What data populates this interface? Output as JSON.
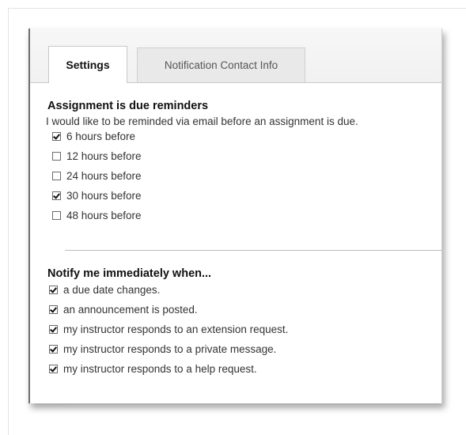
{
  "tabs": {
    "settings_label": "Settings",
    "contact_label": "Notification Contact Info"
  },
  "reminders": {
    "title": "Assignment is due reminders",
    "description": "I would like to be reminded via email before an assignment is due.",
    "options": [
      {
        "label": "6 hours before",
        "checked": true
      },
      {
        "label": "12 hours before",
        "checked": false
      },
      {
        "label": "24 hours before",
        "checked": false
      },
      {
        "label": "30 hours before",
        "checked": true
      },
      {
        "label": "48 hours before",
        "checked": false
      }
    ]
  },
  "notify": {
    "title": "Notify me immediately when...",
    "options": [
      {
        "label": "a due date changes.",
        "checked": true
      },
      {
        "label": "an announcement is posted.",
        "checked": true
      },
      {
        "label": "my instructor responds to an extension request.",
        "checked": true
      },
      {
        "label": "my instructor responds to a private message.",
        "checked": true
      },
      {
        "label": "my instructor responds to a help request.",
        "checked": true
      }
    ]
  }
}
